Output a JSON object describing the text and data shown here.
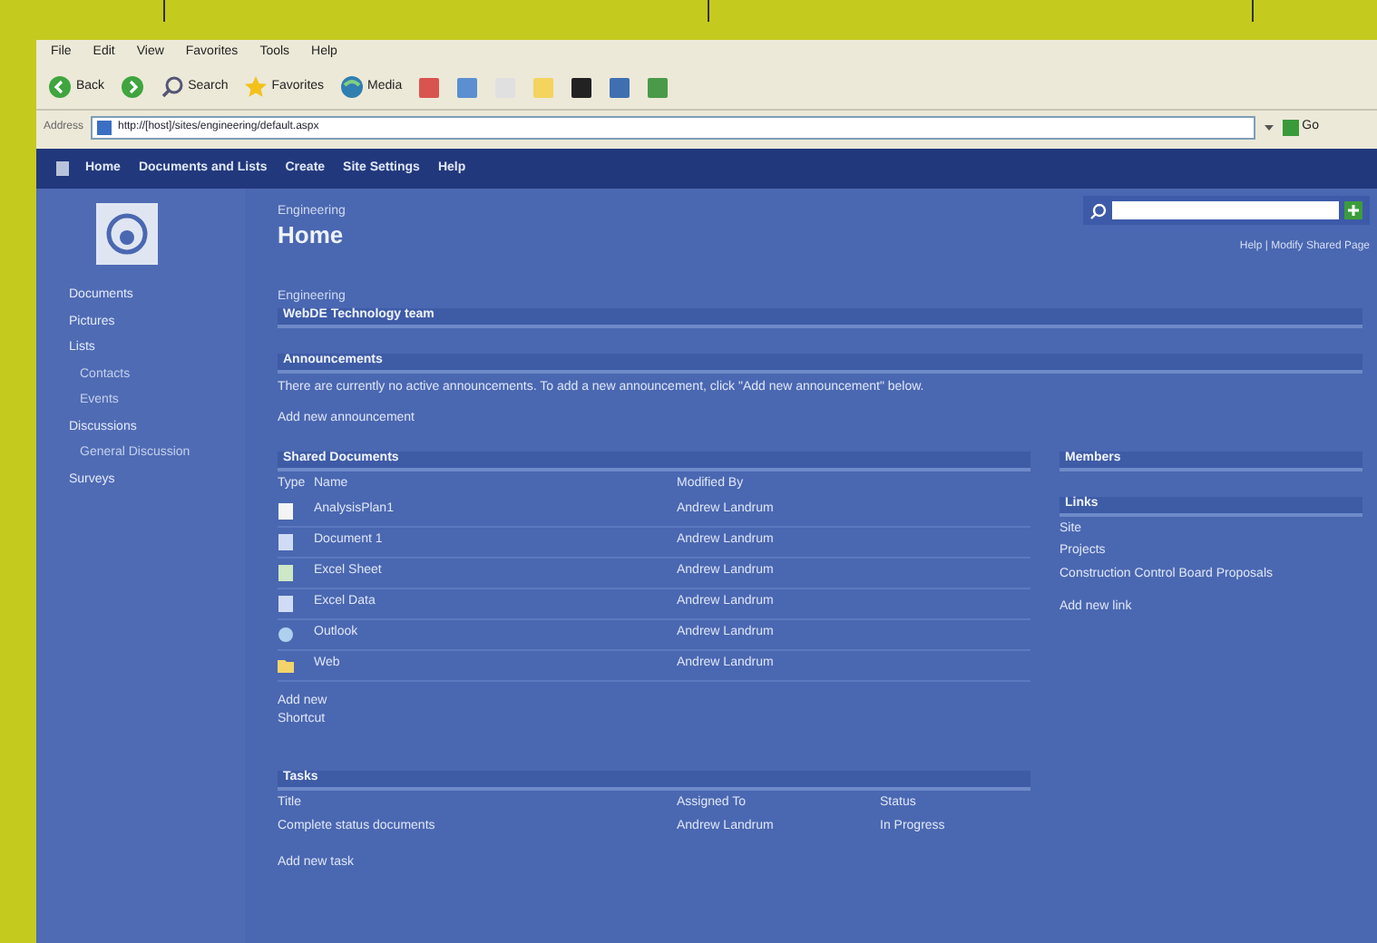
{
  "menu_bar": [
    "File",
    "Edit",
    "View",
    "Favorites",
    "Tools",
    "Help"
  ],
  "toolbar": [
    {
      "kind": "back",
      "label": "Back"
    },
    {
      "kind": "forward"
    },
    {
      "kind": "search",
      "label": "Search"
    },
    {
      "kind": "favorites",
      "label": "Favorites"
    },
    {
      "kind": "media",
      "label": "Media"
    }
  ],
  "address_bar": {
    "label": "Address",
    "value": "http://[host]/sites/engineering/default.aspx",
    "go": "Go"
  },
  "top_nav": [
    "Home",
    "Documents and Lists",
    "Create",
    "Site Settings",
    "Help"
  ],
  "site": {
    "name": "Engineering",
    "page": "Home",
    "links": "Help | Modify Shared Page"
  },
  "quick_launch": [
    {
      "label": "Documents"
    },
    {
      "label": "Pictures"
    },
    {
      "label": "Lists",
      "children": [
        {
          "label": "Contacts"
        },
        {
          "label": "Events"
        }
      ]
    },
    {
      "label": "Discussions",
      "children": [
        {
          "label": "General Discussion"
        }
      ]
    },
    {
      "label": "Surveys"
    }
  ],
  "intro": {
    "label": "Engineering",
    "title": "WebDE Technology team"
  },
  "announcements": {
    "title": "Announcements",
    "text": "There are currently no active announcements. To add a new announcement, click \"Add new announcement\" below.",
    "add": "Add new announcement"
  },
  "shared_documents": {
    "title": "Shared Documents",
    "columns": [
      "Type",
      "Name",
      "Modified By"
    ],
    "rows": [
      {
        "kind": "text",
        "name": "AnalysisPlan1",
        "modified_by": "Andrew Landrum"
      },
      {
        "kind": "word",
        "name": "Document 1",
        "modified_by": "Andrew Landrum"
      },
      {
        "kind": "excel",
        "name": "Excel Sheet",
        "modified_by": "Andrew Landrum"
      },
      {
        "kind": "word",
        "name": "Excel Data",
        "modified_by": "Andrew Landrum"
      },
      {
        "kind": "web",
        "name": "Outlook",
        "modified_by": "Andrew Landrum"
      },
      {
        "kind": "folder",
        "name": "Web",
        "modified_by": "Andrew Landrum"
      }
    ],
    "add": "Add new",
    "extra": "Shortcut"
  },
  "members": {
    "title": "Members"
  },
  "links": {
    "title": "Links",
    "items": [
      "Site",
      "Projects",
      "Construction Control Board Proposals"
    ],
    "add": "Add new link"
  },
  "tasks": {
    "title": "Tasks",
    "columns": [
      "Title",
      "Assigned To",
      "Status"
    ],
    "rows": [
      {
        "title": "Complete status documents",
        "assigned_to": "Andrew Landrum",
        "status": "In Progress"
      }
    ],
    "add": "Add new task"
  }
}
